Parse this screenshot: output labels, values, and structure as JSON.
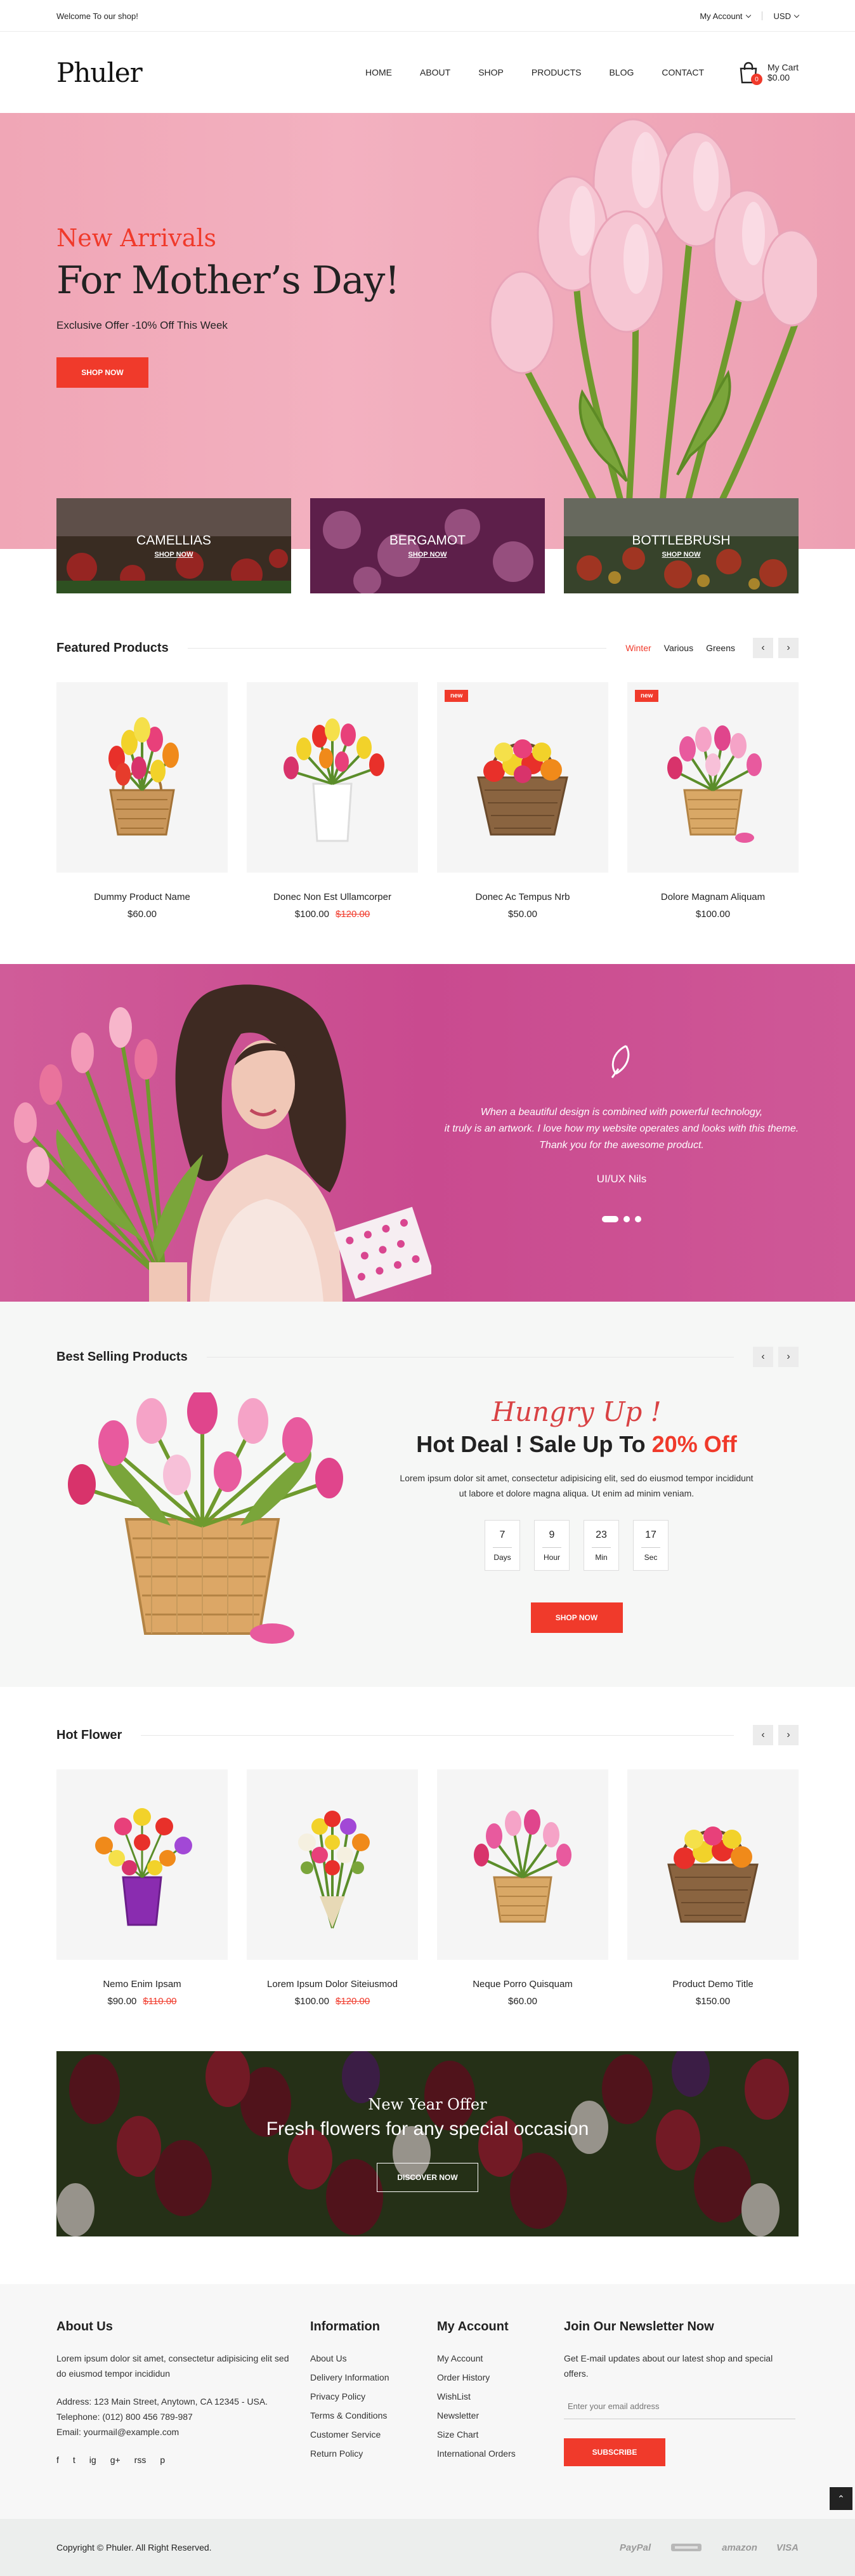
{
  "topbar": {
    "welcome": "Welcome To our shop!",
    "account": "My Account",
    "currency": "USD"
  },
  "header": {
    "logo": "Phuler",
    "nav": [
      "HOME",
      "ABOUT",
      "SHOP",
      "PRODUCTS",
      "BLOG",
      "CONTACT"
    ],
    "cart_label": "My Cart",
    "cart_total": "$0.00",
    "cart_count": "0"
  },
  "hero": {
    "kicker": "New Arrivals",
    "title": "For Mother’s Day!",
    "subtitle": "Exclusive Offer -10% Off This Week",
    "button": "SHOP NOW"
  },
  "categories": [
    {
      "name": "CAMELLIAS",
      "link": "SHOP NOW"
    },
    {
      "name": "BERGAMOT",
      "link": "SHOP NOW"
    },
    {
      "name": "BOTTLEBRUSH",
      "link": "SHOP NOW"
    }
  ],
  "featured": {
    "title": "Featured Products",
    "tabs": [
      "Winter",
      "Various",
      "Greens"
    ],
    "products": [
      {
        "name": "Dummy Product Name",
        "price": "$60.00",
        "old_price": "",
        "badge": ""
      },
      {
        "name": "Donec Non Est Ullamcorper",
        "price": "$100.00",
        "old_price": "$120.00",
        "badge": ""
      },
      {
        "name": "Donec Ac Tempus Nrb",
        "price": "$50.00",
        "old_price": "",
        "badge": "new"
      },
      {
        "name": "Dolore Magnam Aliquam",
        "price": "$100.00",
        "old_price": "",
        "badge": "new"
      }
    ]
  },
  "testimonial": {
    "text_1": "When a beautiful design is combined with powerful technology,",
    "text_2": "it truly is an artwork. I love how my website operates and looks with this theme.",
    "text_3": "Thank you for the awesome product.",
    "name": "UI/UX Nils"
  },
  "best_selling": {
    "title": "Best Selling Products",
    "script": "Hungry Up !",
    "deal_prefix": "Hot Deal ! Sale Up To ",
    "deal_highlight": "20% Off",
    "desc_1": "Lorem ipsum dolor sit amet, consectetur adipisicing elit, sed do eiusmod tempor incididunt",
    "desc_2": "ut labore et dolore magna aliqua. Ut enim ad minim veniam.",
    "countdown": [
      {
        "value": "7",
        "label": "Days"
      },
      {
        "value": "9",
        "label": "Hour"
      },
      {
        "value": "23",
        "label": "Min"
      },
      {
        "value": "17",
        "label": "Sec"
      }
    ],
    "button": "SHOP NOW"
  },
  "hot_flower": {
    "title": "Hot Flower",
    "products": [
      {
        "name": "Nemo Enim Ipsam",
        "price": "$90.00",
        "old_price": "$110.00"
      },
      {
        "name": "Lorem Ipsum Dolor Siteiusmod",
        "price": "$100.00",
        "old_price": "$120.00"
      },
      {
        "name": "Neque Porro Quisquam",
        "price": "$60.00",
        "old_price": ""
      },
      {
        "name": "Product Demo Title",
        "price": "$150.00",
        "old_price": ""
      }
    ]
  },
  "new_year": {
    "kicker": "New Year Offer",
    "title": "Fresh flowers for any special occasion",
    "button": "DISCOVER NOW"
  },
  "footer": {
    "about_title": "About Us",
    "about_text": "Lorem ipsum dolor sit amet, consectetur adipisicing elit sed do eiusmod tempor incididun",
    "address": "Address: 123 Main Street, Anytown, CA 12345 - USA.",
    "phone": "Telephone: (012) 800 456 789-987",
    "email": "Email: yourmail@example.com",
    "info_title": "Information",
    "info_links": [
      "About Us",
      "Delivery Information",
      "Privacy Policy",
      "Terms & Conditions",
      "Customer Service",
      "Return Policy"
    ],
    "account_title": "My Account",
    "account_links": [
      "My Account",
      "Order History",
      "WishList",
      "Newsletter",
      "Size Chart",
      "International Orders"
    ],
    "newsletter_title": "Join Our Newsletter Now",
    "newsletter_text": "Get E-mail updates about our latest shop and special offers.",
    "newsletter_placeholder": "Enter your email address",
    "subscribe": "SUBSCRIBE",
    "social": [
      "f",
      "t",
      "ig",
      "g+",
      "rss",
      "p"
    ],
    "copyright": "Copyright © Phuler. All Right Reserved.",
    "payments": [
      "PayPal",
      "",
      "amazon",
      "VISA"
    ]
  },
  "colors": {
    "accent": "#f03a2b",
    "hero_bg": "#f3b1c0",
    "testimonial_bg": "#c94a8f"
  }
}
